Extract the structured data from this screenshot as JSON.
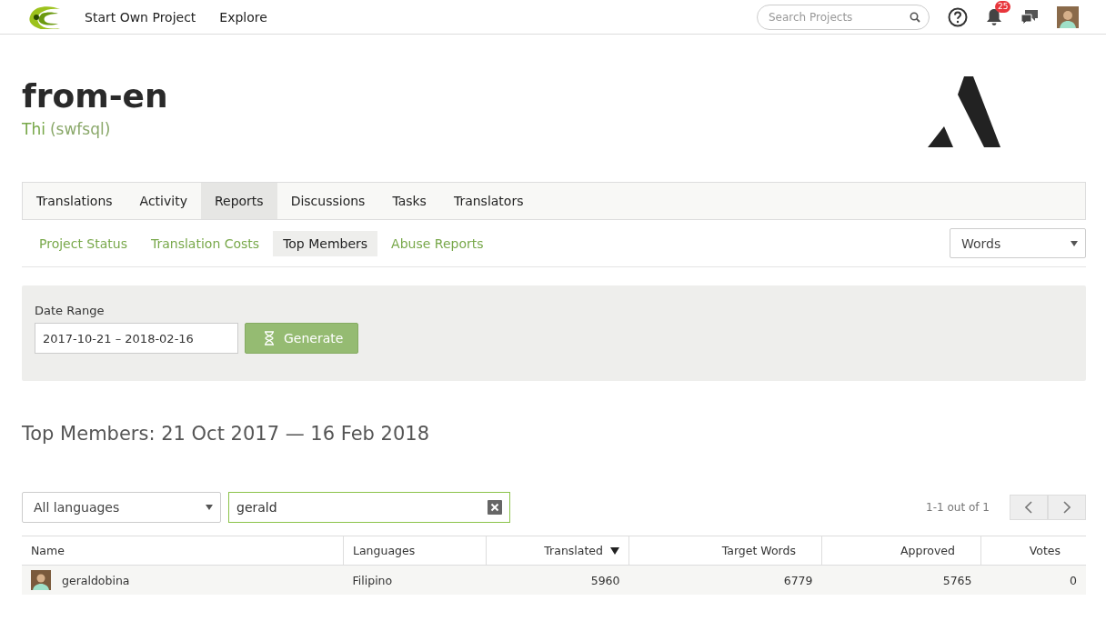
{
  "topbar": {
    "links": [
      "Start Own Project",
      "Explore"
    ],
    "search": {
      "placeholder": "Search Projects"
    },
    "notifications": "25"
  },
  "project": {
    "title": "from-en",
    "owner": "Thi",
    "owner_handle": "(swfsql)"
  },
  "tabs": [
    {
      "label": "Translations",
      "selected": false
    },
    {
      "label": "Activity",
      "selected": false
    },
    {
      "label": "Reports",
      "selected": true
    },
    {
      "label": "Discussions",
      "selected": false
    },
    {
      "label": "Tasks",
      "selected": false
    },
    {
      "label": "Translators",
      "selected": false
    }
  ],
  "subtabs": [
    {
      "label": "Project Status",
      "selected": false
    },
    {
      "label": "Translation Costs",
      "selected": false
    },
    {
      "label": "Top Members",
      "selected": true
    },
    {
      "label": "Abuse Reports",
      "selected": false
    }
  ],
  "unit_select": {
    "value": "Words"
  },
  "filter": {
    "label": "Date Range",
    "value": "2017-10-21 – 2018-02-16",
    "button": "Generate"
  },
  "report_title": "Top Members: 21 Oct 2017 — 16 Feb 2018",
  "language_select": {
    "value": "All languages"
  },
  "member_search": {
    "value": "gerald"
  },
  "pagination": "1-1 out of 1",
  "table": {
    "columns": [
      {
        "label": "Name",
        "sorted": false
      },
      {
        "label": "Languages",
        "sorted": false
      },
      {
        "label": "Translated",
        "sorted": true
      },
      {
        "label": "Target Words",
        "sorted": false
      },
      {
        "label": "Approved",
        "sorted": false
      },
      {
        "label": "Votes",
        "sorted": false
      }
    ],
    "rows": [
      {
        "cells": [
          "geraldobina",
          "Filipino",
          "5960",
          "6779",
          "5765",
          "0"
        ]
      }
    ]
  }
}
